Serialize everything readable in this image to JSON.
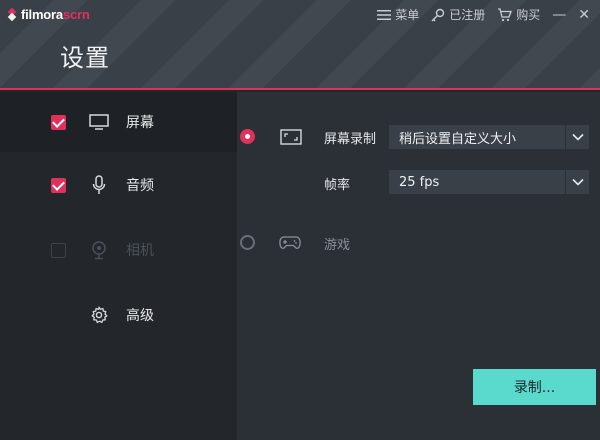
{
  "app": {
    "logo_main": "filmora",
    "logo_accent": "scrn",
    "logo_mark_superscript": "™"
  },
  "topmenu": {
    "menu_label": "菜单",
    "register_label": "已注册",
    "buy_label": "购买",
    "minimize": "—",
    "close": "✕"
  },
  "page": {
    "title": "设置"
  },
  "sidebar": {
    "items": [
      {
        "label": "屏幕",
        "checked": true,
        "enabled": true,
        "icon": "monitor-icon"
      },
      {
        "label": "音频",
        "checked": true,
        "enabled": true,
        "icon": "microphone-icon"
      },
      {
        "label": "相机",
        "checked": false,
        "enabled": false,
        "icon": "webcam-icon"
      },
      {
        "label": "高级",
        "checked": null,
        "enabled": true,
        "icon": "gear-icon"
      }
    ]
  },
  "screen_options": {
    "capture_mode": {
      "selected": true,
      "label": "屏幕录制",
      "size_value": "稍后设置自定义大小",
      "icon": "expand-region-icon"
    },
    "frame_rate": {
      "label": "帧率",
      "value": "25 fps"
    },
    "game_mode": {
      "selected": false,
      "label": "游戏",
      "icon": "gamepad-icon"
    }
  },
  "actions": {
    "record_label": "录制..."
  },
  "colors": {
    "accent": "#e0315d",
    "record_button": "#5ad9cd",
    "header_bg": "#3a4048",
    "panel_bg": "#2b3036"
  }
}
